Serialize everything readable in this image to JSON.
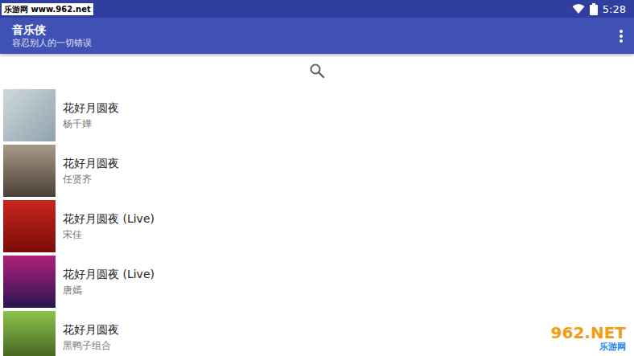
{
  "status_bar": {
    "time": "5:28"
  },
  "app_bar": {
    "title": "音乐侠",
    "subtitle": "容忍别人的一切错误"
  },
  "songs": [
    {
      "title": "花好月圆夜",
      "artist": "杨千嬅"
    },
    {
      "title": "花好月圆夜",
      "artist": "任贤齐"
    },
    {
      "title": "花好月圆夜 (Live)",
      "artist": "宋佳"
    },
    {
      "title": "花好月圆夜 (Live)",
      "artist": "唐嫣"
    },
    {
      "title": "花好月圆夜",
      "artist": "黑鸭子组合"
    }
  ],
  "watermarks": {
    "top": "乐游网 www.962.net",
    "bottom_brand": "962.NET",
    "bottom_site": "乐游网"
  }
}
